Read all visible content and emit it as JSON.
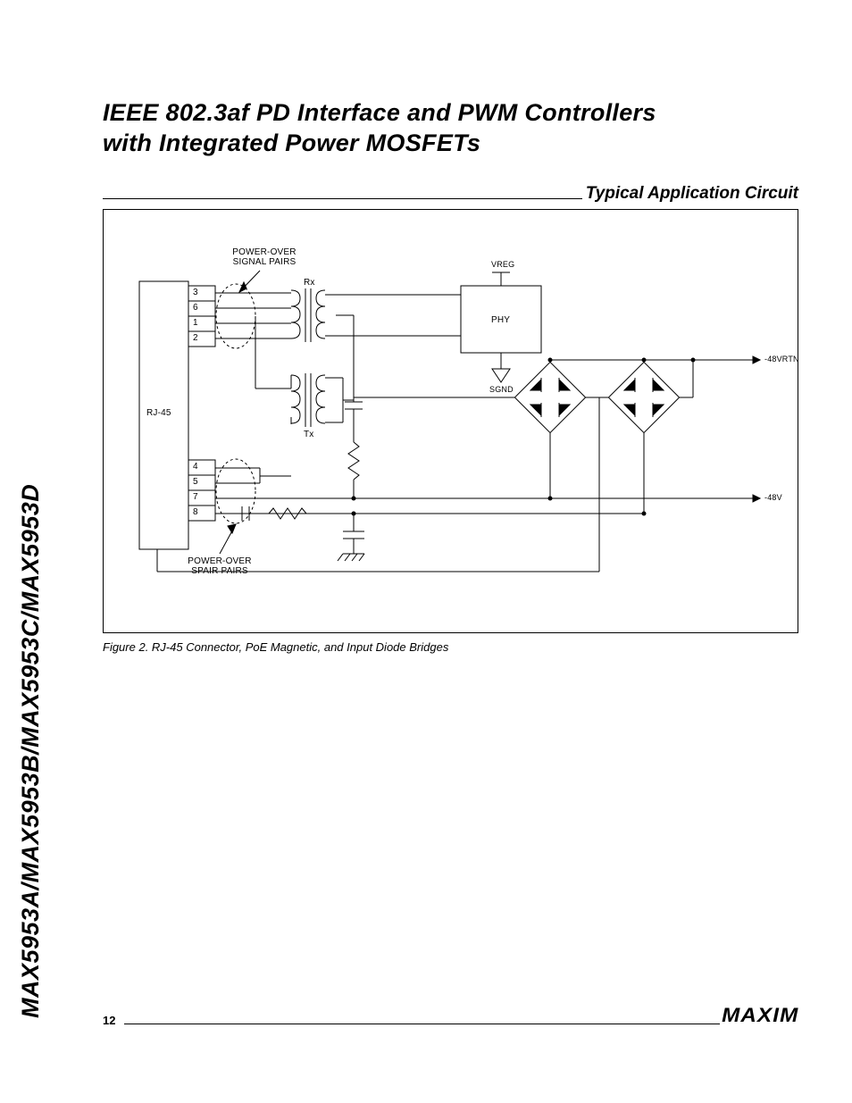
{
  "sidelabel": "MAX5953A/MAX5953B/MAX5953C/MAX5953D",
  "title_line1": "IEEE 802.3af PD Interface and PWM Controllers",
  "title_line2": "with Integrated Power MOSFETs",
  "section_heading": "Typical Application Circuit",
  "figure_caption": "Figure 2. RJ-45 Connector, PoE Magnetic, and Input Diode Bridges",
  "page_number": "12",
  "brand": "MAXIM",
  "chart_data": {
    "type": "diagram",
    "title": "RJ-45 Connector, PoE Magnetic, and Input Diode Bridges",
    "blocks": {
      "connector": {
        "label": "RJ-45",
        "pins_top": [
          "3",
          "6",
          "1",
          "2"
        ],
        "pins_bottom": [
          "4",
          "5",
          "7",
          "8"
        ]
      },
      "transformer_top": {
        "label": "Rx"
      },
      "transformer_bottom": {
        "label": "Tx"
      },
      "phy_block": {
        "label": "PHY",
        "top": "VREG",
        "bottom": "SGND"
      },
      "bridges": [
        "diode_bridge_left",
        "diode_bridge_right"
      ],
      "rails": {
        "top": "-48VRTN",
        "bottom": "-48V"
      },
      "annotations": {
        "signal_pairs": "POWER-OVER SIGNAL PAIRS",
        "spare_pairs": "POWER-OVER SPAIR PAIRS"
      },
      "passives": [
        "resistor",
        "cap_small",
        "cap_large",
        "ground"
      ]
    }
  },
  "labels": {
    "rj45": "RJ-45",
    "pin3": "3",
    "pin6": "6",
    "pin1": "1",
    "pin2": "2",
    "pin4": "4",
    "pin5": "5",
    "pin7": "7",
    "pin8": "8",
    "signal_pairs_l1": "POWER-OVER",
    "signal_pairs_l2": "SIGNAL PAIRS",
    "spare_pairs_l1": "POWER-OVER",
    "spare_pairs_l2": "SPAIR PAIRS",
    "rx": "Rx",
    "tx": "Tx",
    "phy": "PHY",
    "vreg": "VREG",
    "sgnd": "SGND",
    "rail_top": "-48VRTN",
    "rail_bot": "-48V"
  }
}
